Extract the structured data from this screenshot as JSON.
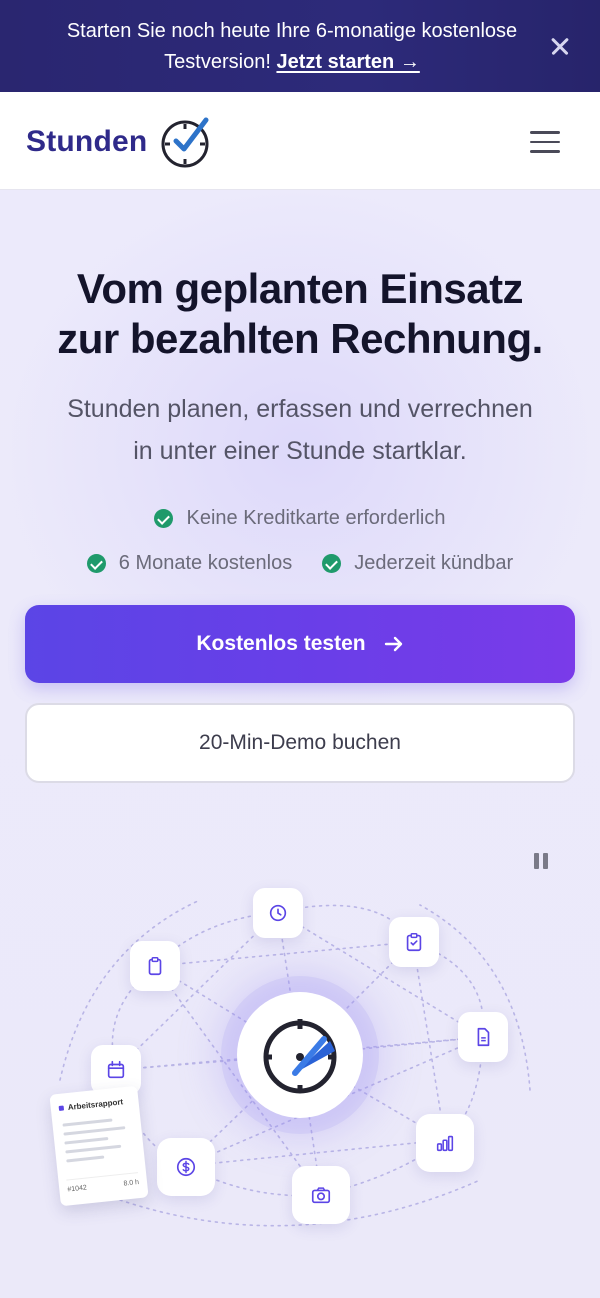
{
  "promo": {
    "text": "Starten Sie noch heute Ihre 6-monatige kostenlose Testversion!",
    "cta": "Jetzt starten →"
  },
  "header": {
    "brand": "Stunden"
  },
  "hero": {
    "title_line1": "Vom geplanten Einsatz",
    "title_line2": "zur bezahlten Rechnung.",
    "subtitle_line1": "Stunden planen, erfassen und verrechnen",
    "subtitle_line2": "in unter einer Stunde startklar.",
    "checks": [
      "Keine Kreditkarte erforderlich",
      "6 Monate kostenlos",
      "Jederzeit kündbar"
    ],
    "primary_button": "Kostenlos testen",
    "secondary_button": "20-Min-Demo buchen"
  },
  "illustration": {
    "report_title": "Arbeitsrapport",
    "report_number": "#1042",
    "report_hours": "8.0 h",
    "icons": [
      "clock-icon",
      "clipboard-check-icon",
      "clipboard-icon",
      "document-icon",
      "calendar-icon",
      "bar-chart-icon",
      "dollar-icon",
      "camera-icon"
    ]
  },
  "colors": {
    "brand": "#2f2a8a",
    "accent": "#5b45e6",
    "banner": "#2a2670",
    "check": "#1f9a6b"
  }
}
